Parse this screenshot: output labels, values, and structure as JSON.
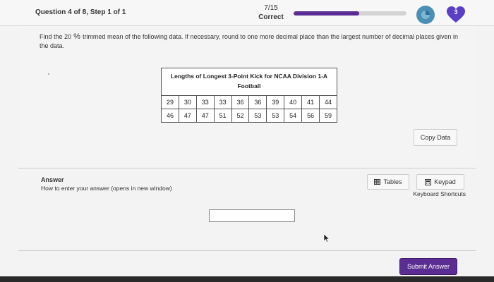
{
  "header": {
    "question_label": "Question 4 of 8, Step 1 of 1",
    "score": "7/15",
    "status": "Correct",
    "progress": 0.58,
    "hearts": "3",
    "accent_color": "#5b2c91"
  },
  "question": {
    "prompt_part1": "Find the 20",
    "prompt_pct": " % ",
    "prompt_part2": "trimmed mean of the following data. If necessary, round to one more decimal place than the largest number of decimal places given in the data.",
    "table_title": "Lengths of Longest 3-Point Kick for NCAA Division 1-A Football",
    "rows": [
      [
        "29",
        "30",
        "33",
        "33",
        "36",
        "36",
        "39",
        "40",
        "41",
        "44"
      ],
      [
        "46",
        "47",
        "47",
        "51",
        "52",
        "53",
        "53",
        "54",
        "56",
        "59"
      ]
    ],
    "copy_label": "Copy Data"
  },
  "answer": {
    "title": "Answer",
    "help_link": "How to enter your answer (opens in new window)",
    "tables_label": "Tables",
    "keypad_label": "Keypad",
    "keyboard_link": "Keyboard Shortcuts",
    "input_value": "",
    "submit_label": "Submit Answer"
  }
}
